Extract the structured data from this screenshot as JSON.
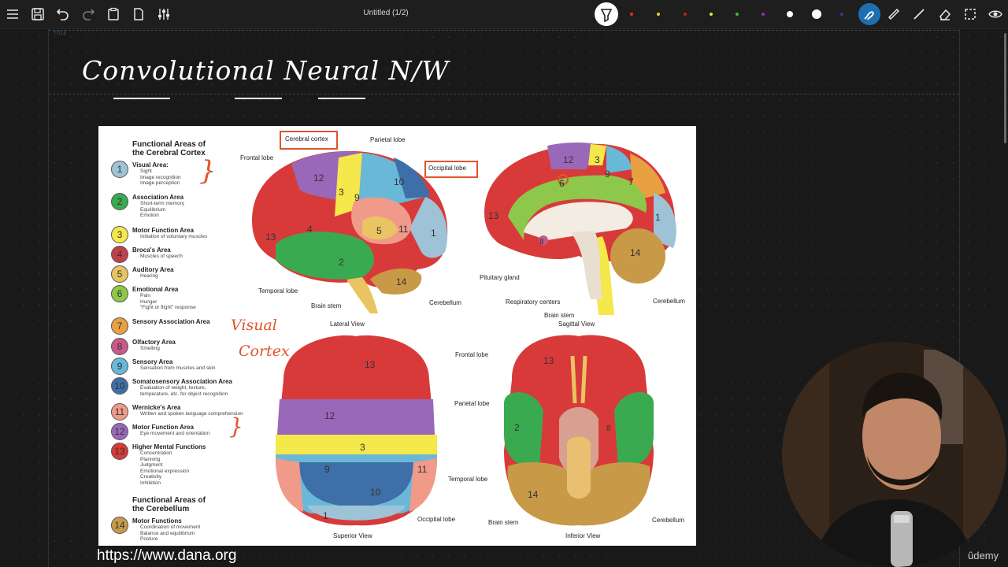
{
  "toolbar": {
    "doc_title": "Untitled (1/2)",
    "icons": [
      "menu-icon",
      "save-icon",
      "undo-icon",
      "redo-icon",
      "clipboard-icon",
      "page-icon",
      "sliders-icon"
    ],
    "right_icons": [
      "pen-icon",
      "ruler-icon",
      "line-icon",
      "eraser-icon",
      "select-icon",
      "view-icon"
    ],
    "palette": [
      "#e03030",
      "#e0d030",
      "#c02020",
      "#e0e040",
      "#30c040",
      "#8a30c0"
    ]
  },
  "canvas": {
    "title": "Convolutional Neural N/W",
    "title_area_tag": "TITLE"
  },
  "diagram": {
    "legend_heading": "Functional Areas of\nthe Cerebral Cortex",
    "legend": [
      {
        "n": "1",
        "color": "#9ec3d6",
        "title": "Visual Area:",
        "sub": [
          "Sight",
          "Image recognition",
          "Image perception"
        ]
      },
      {
        "n": "2",
        "color": "#3aaa50",
        "title": "Association Area",
        "sub": [
          "Short-term memory",
          "Equilibrium",
          "Emotion"
        ]
      },
      {
        "n": "3",
        "color": "#f4e84a",
        "title": "Motor Function Area",
        "sub": [
          "Initiation of voluntary muscles"
        ]
      },
      {
        "n": "4",
        "color": "#c0404a",
        "title": "Broca's Area",
        "sub": [
          "Muscles of speech"
        ]
      },
      {
        "n": "5",
        "color": "#e8c462",
        "title": "Auditory Area",
        "sub": [
          "Hearing"
        ]
      },
      {
        "n": "6",
        "color": "#8ec84a",
        "title": "Emotional Area",
        "sub": [
          "Pain",
          "Hunger",
          "\"Fight or flight\" response"
        ]
      },
      {
        "n": "7",
        "color": "#e8a040",
        "title": "Sensory Association Area",
        "sub": []
      },
      {
        "n": "8",
        "color": "#c85a8a",
        "title": "Olfactory Area",
        "sub": [
          "Smelling"
        ]
      },
      {
        "n": "9",
        "color": "#6ab8d8",
        "title": "Sensory Area",
        "sub": [
          "Sensation from muscles and skin"
        ]
      },
      {
        "n": "10",
        "color": "#3e6fa8",
        "title": "Somatosensory Association Area",
        "sub": [
          "Evaluation of weight, texture,",
          "temperature, etc. for object recognition"
        ]
      },
      {
        "n": "11",
        "color": "#f09a8a",
        "title": "Wernicke's Area",
        "sub": [
          "Written and spoken language comprehension"
        ]
      },
      {
        "n": "12",
        "color": "#9a68b8",
        "title": "Motor Function Area",
        "sub": [
          "Eye movement and orientation"
        ]
      },
      {
        "n": "13",
        "color": "#d83a3a",
        "title": "Higher Mental Functions",
        "sub": [
          "Concentration",
          "Planning",
          "Judgment",
          "Emotional expression",
          "Creativity",
          "Inhibition"
        ]
      }
    ],
    "legend_heading2": "Functional Areas of\nthe Cerebellum",
    "legend2": [
      {
        "n": "14",
        "color": "#c89a48",
        "title": "Motor Functions",
        "sub": [
          "Coordination of movement",
          "Balance and equilibrium",
          "Posture"
        ]
      }
    ],
    "labels": {
      "cerebral_cortex": "Cerebral cortex",
      "parietal_lobe": "Parietal lobe",
      "frontal_lobe": "Frontal lobe",
      "occipital_lobe": "Occipital lobe",
      "temporal_lobe": "Temporal lobe",
      "brain_stem": "Brain stem",
      "cerebellum": "Cerebellum",
      "lateral_view": "Lateral View",
      "pituitary_gland": "Pituitary gland",
      "respiratory_centers": "Respiratory centers",
      "sagittal_view": "Sagittal View",
      "superior_view": "Superior View",
      "inferior_view": "Inferior View"
    },
    "handwriting": {
      "visual": "Visual",
      "cortex": "Cortex"
    }
  },
  "url": "https://www.dana.org",
  "watermark": "ûdemy"
}
